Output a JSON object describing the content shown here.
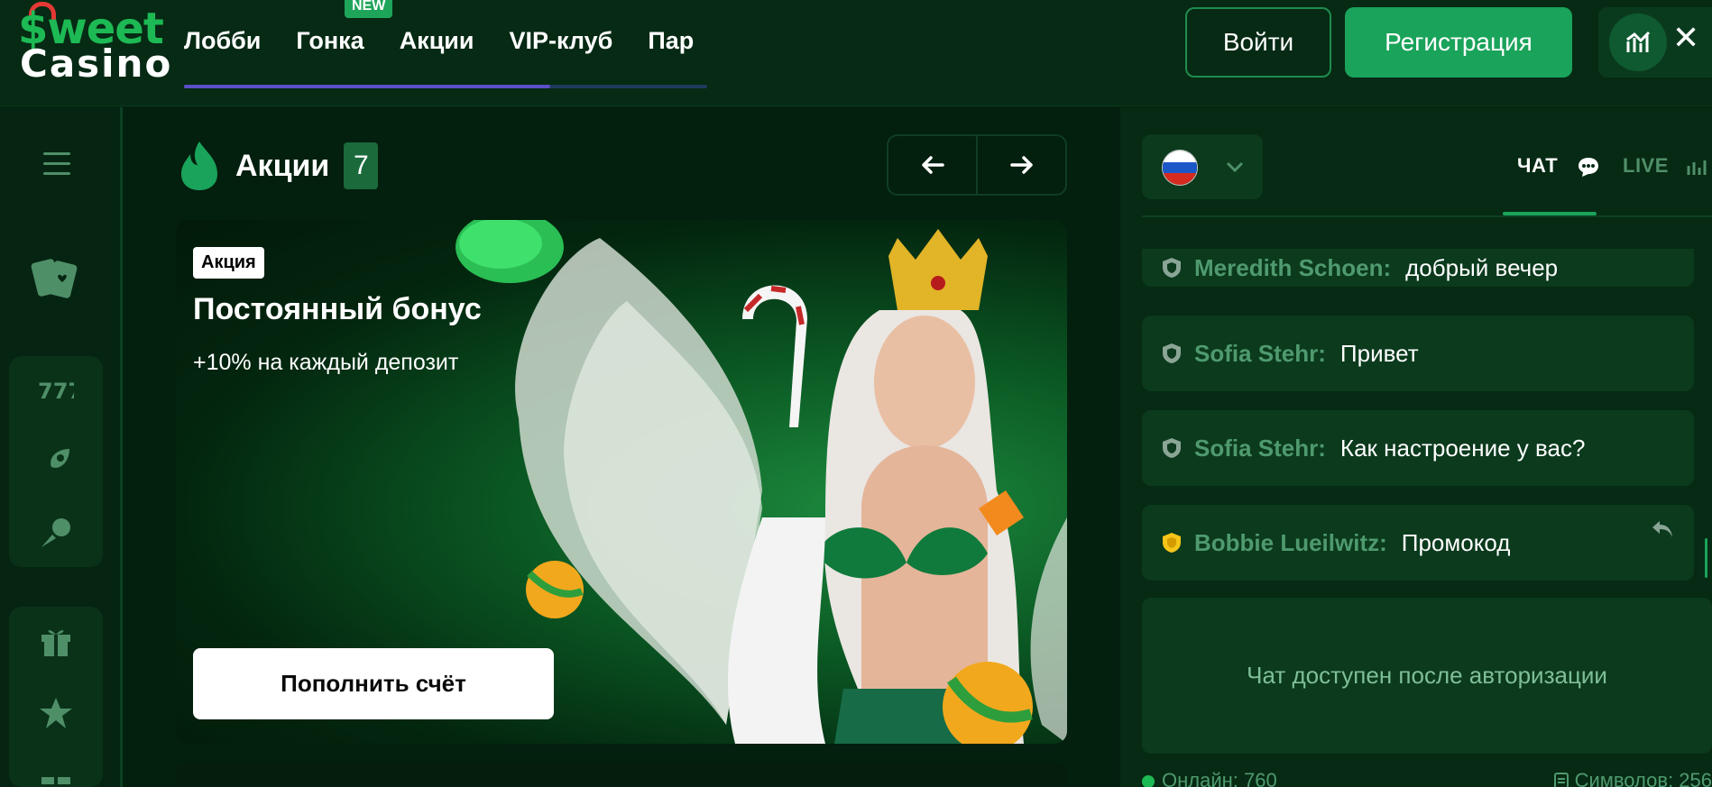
{
  "brand": {
    "logo_top": "$weet",
    "logo_bottom": "Casino"
  },
  "nav": {
    "items": [
      "Лобби",
      "Гонка",
      "Акции",
      "VIP-клуб",
      "Пар"
    ],
    "new_badge": "NEW",
    "scroll_fraction": 0.7
  },
  "header": {
    "login_label": "Войти",
    "register_label": "Регистрация",
    "close_label": "✕"
  },
  "promo": {
    "title": "Акции",
    "count": "7",
    "prev_label": "←",
    "next_label": "→"
  },
  "banner": {
    "tag": "Акция",
    "title": "Постоянный бонус",
    "subtitle": "+10% на каждый депозит",
    "button_label": "Пополнить счёт"
  },
  "chat": {
    "tab_chat": "ЧАТ",
    "tab_live": "LIVE",
    "messages": [
      {
        "user": "Meredith Schoen:",
        "text": "добрый вечер",
        "badge_color": "#8aa596"
      },
      {
        "user": "Sofia Stehr:",
        "text": "Привет",
        "badge_color": "#8aa596"
      },
      {
        "user": "Sofia Stehr:",
        "text": "Как настроение у вас?",
        "badge_color": "#8aa596"
      },
      {
        "user": "Bobbie Lueilwitz:",
        "text": "Промокод",
        "badge_color": "#f5c518"
      }
    ],
    "locked_text": "Чат доступен после авторизации",
    "online_label": "Онлайн: 760",
    "chars_label": "Символов: 256"
  },
  "colors": {
    "accent": "#1aa35a",
    "background": "#03210f",
    "panel": "#0b3a1d"
  }
}
